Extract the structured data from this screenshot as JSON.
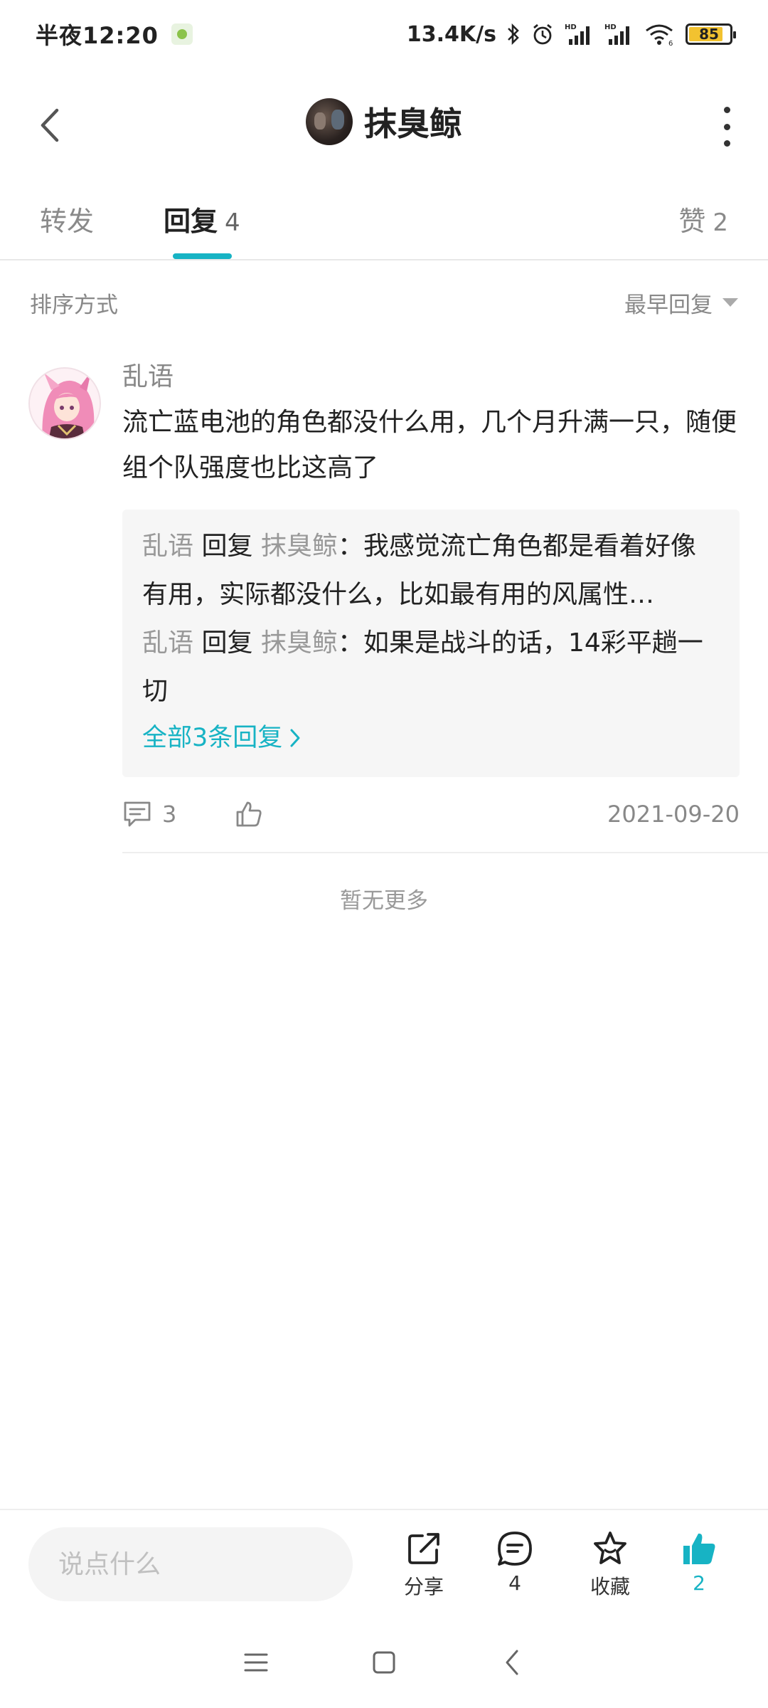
{
  "status_bar": {
    "time": "半夜12:20",
    "network_speed": "13.4K/s",
    "battery_percent": "85",
    "battery_level": 0.85
  },
  "header": {
    "title": "抹臭鲸",
    "back_icon": "chevron-left-icon",
    "more_icon": "more-vertical-icon"
  },
  "tabs": [
    {
      "label": "转发",
      "count": ""
    },
    {
      "label": "回复",
      "count": "4",
      "active": true
    },
    {
      "label": "赞",
      "count": "2"
    }
  ],
  "sort": {
    "label": "排序方式",
    "selected": "最早回复"
  },
  "comments": [
    {
      "user": "乱语",
      "text": "流亡蓝电池的角色都没什么用，几个月升满一只，随便组个队强度也比这高了",
      "replies": [
        {
          "from": "乱语",
          "verb": "回复",
          "to": "抹臭鲸",
          "text": "：我感觉流亡角色都是看着好像有用，实际都没什么，比如最有用的风属性…"
        },
        {
          "from": "乱语",
          "verb": "回复",
          "to": "抹臭鲸",
          "text": "：如果是战斗的话，14彩平趟一切"
        }
      ],
      "all_replies_label": "全部3条回复",
      "reply_count": "3",
      "date": "2021-09-20"
    }
  ],
  "no_more": "暂无更多",
  "bottom_bar": {
    "input_placeholder": "说点什么",
    "share_label": "分享",
    "comment_count": "4",
    "favorite_label": "收藏",
    "like_count": "2"
  },
  "colors": {
    "accent": "#17b3c4",
    "text_primary": "#222222",
    "text_secondary": "#888888"
  }
}
